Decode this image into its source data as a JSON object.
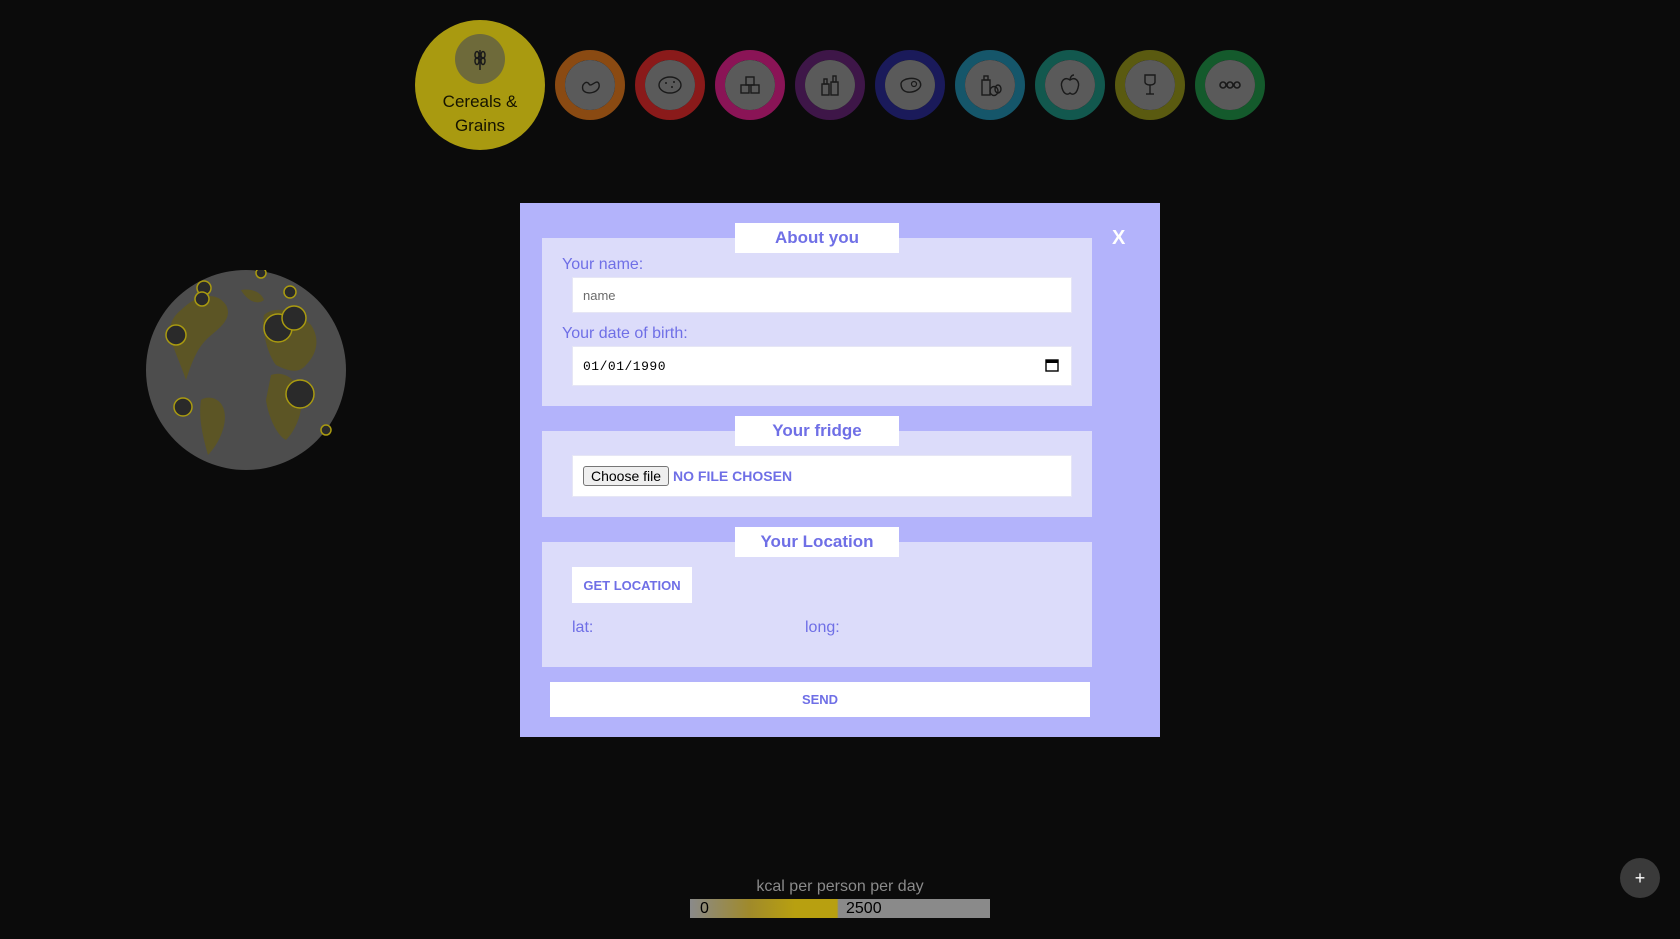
{
  "categories": {
    "active_label": "Cereals & Grains",
    "items": [
      {
        "name": "cereals-grains",
        "color": "#a99a10",
        "icon": "wheat-icon"
      },
      {
        "name": "pulses",
        "color": "#8a4a12",
        "icon": "bean-icon"
      },
      {
        "name": "starchy-roots",
        "color": "#8a1a1a",
        "icon": "potato-icon"
      },
      {
        "name": "sugar",
        "color": "#8a1456",
        "icon": "sugar-cubes-icon"
      },
      {
        "name": "oils-fats",
        "color": "#3e1648",
        "icon": "oil-bottles-icon"
      },
      {
        "name": "meat",
        "color": "#1a1a5a",
        "icon": "steak-icon"
      },
      {
        "name": "dairy-eggs",
        "color": "#15566a",
        "icon": "milk-eggs-icon"
      },
      {
        "name": "fruit-vegetables",
        "color": "#12584e",
        "icon": "apple-icon"
      },
      {
        "name": "alcoholic-beverages",
        "color": "#5a5a10",
        "icon": "wine-glass-icon"
      },
      {
        "name": "other",
        "color": "#145a2c",
        "icon": "more-icon"
      }
    ]
  },
  "modal": {
    "close_label": "X",
    "about": {
      "legend": "About you",
      "name_label": "Your name:",
      "name_placeholder": "name",
      "dob_label": "Your date of birth:",
      "dob_value": "01/01/1990"
    },
    "fridge": {
      "legend": "Your fridge",
      "choose_label": "Choose file",
      "status": "NO FILE CHOSEN"
    },
    "location": {
      "legend": "Your Location",
      "button_label": "GET LOCATION",
      "lat_label": "lat:",
      "long_label": "long:"
    },
    "send_label": "SEND"
  },
  "legend_bar": {
    "title": "kcal per person per day",
    "min": "0",
    "max": "2500"
  },
  "plus_label": "+"
}
